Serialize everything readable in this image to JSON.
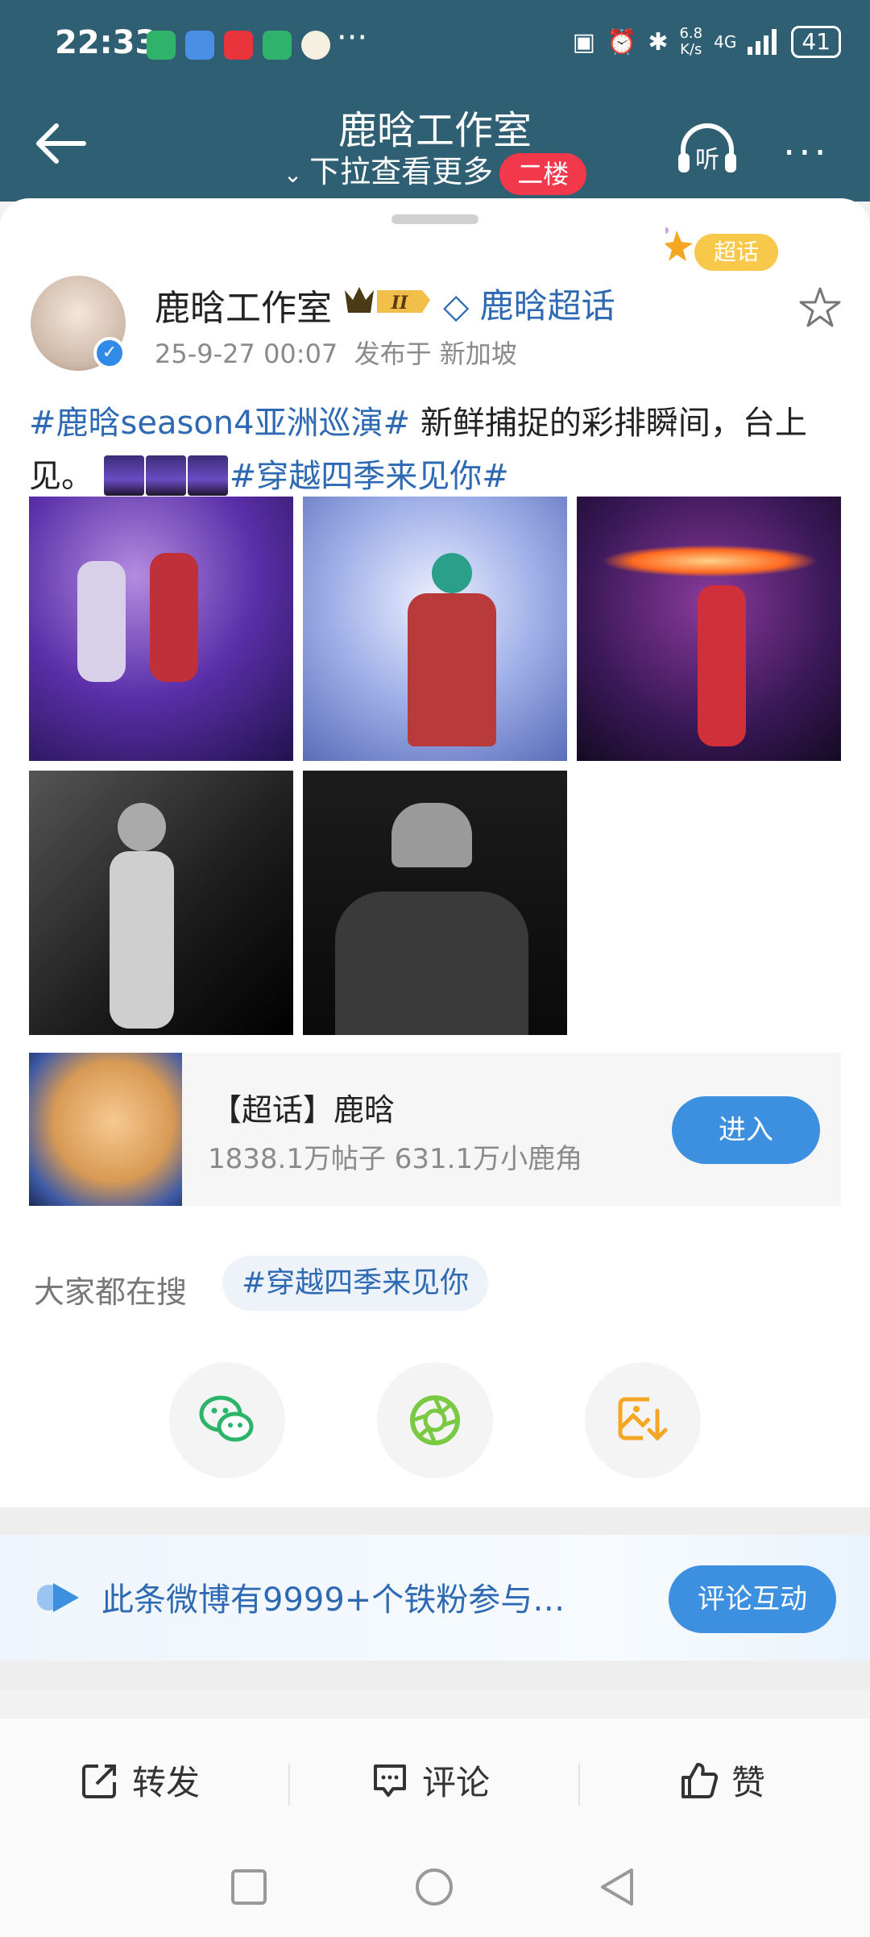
{
  "status_bar": {
    "time": "22:33",
    "dots": "···",
    "net_speed_value": "6.8",
    "net_speed_unit": "K/s",
    "network": "4G",
    "battery": "41"
  },
  "nav": {
    "title": "鹿晗工作室",
    "subtitle": "下拉查看更多",
    "floor_badge": "二楼",
    "listen_label": "听",
    "more_label": "···"
  },
  "post": {
    "super_badge": "超话",
    "author": "鹿晗工作室",
    "level_badge": "II",
    "supertopic_link": "鹿晗超话",
    "time": "25-9-27 00:07",
    "location": "发布于 新加坡",
    "hashtag1": "#鹿晗season4亚洲巡演#",
    "text": " 新鲜捕捉的彩排瞬间，台上见。",
    "hashtag2": "#穿越四季来见你#",
    "photos": [
      "photo-1",
      "photo-2",
      "photo-3",
      "photo-4",
      "photo-5"
    ]
  },
  "supertopic_card": {
    "title": "【超话】鹿晗",
    "stats": "1838.1万帖子 631.1万小鹿角",
    "enter_label": "进入"
  },
  "search": {
    "label": "大家都在搜",
    "chip": "#穿越四季来见你"
  },
  "share_icons": [
    "wechat-icon",
    "moments-icon",
    "save-image-icon"
  ],
  "fan_banner": {
    "text": "此条微博有9999+个铁粉参与…",
    "button": "评论互动"
  },
  "actions": {
    "repost": "转发",
    "comment": "评论",
    "like": "赞"
  },
  "colors": {
    "header_bg": "#2f5f72",
    "link_blue": "#2e69b3",
    "button_blue": "#3d8fe0",
    "floor_red": "#f2384b"
  }
}
